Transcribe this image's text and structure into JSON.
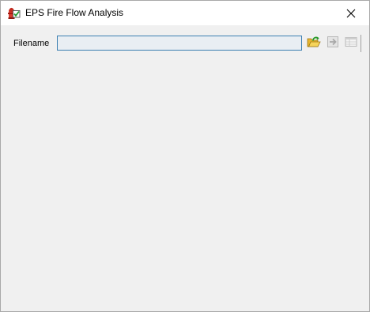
{
  "window": {
    "title": "EPS Fire Flow Analysis",
    "icon": "fire-hydrant-check-icon"
  },
  "title_bar": {
    "close_icon": "close-icon"
  },
  "form": {
    "filename_label": "Filename",
    "filename_value": "",
    "filename_placeholder": ""
  },
  "toolbar": {
    "open_icon": "open-folder-icon",
    "run_icon": "arrow-right-icon",
    "run_enabled": false,
    "grid_icon": "table-view-icon",
    "grid_enabled": false
  },
  "colors": {
    "input_border": "#3c7fb1",
    "input_background": "#e9eef3",
    "window_background": "#f0f0f0",
    "disabled_icon": "#b8b8b8"
  }
}
